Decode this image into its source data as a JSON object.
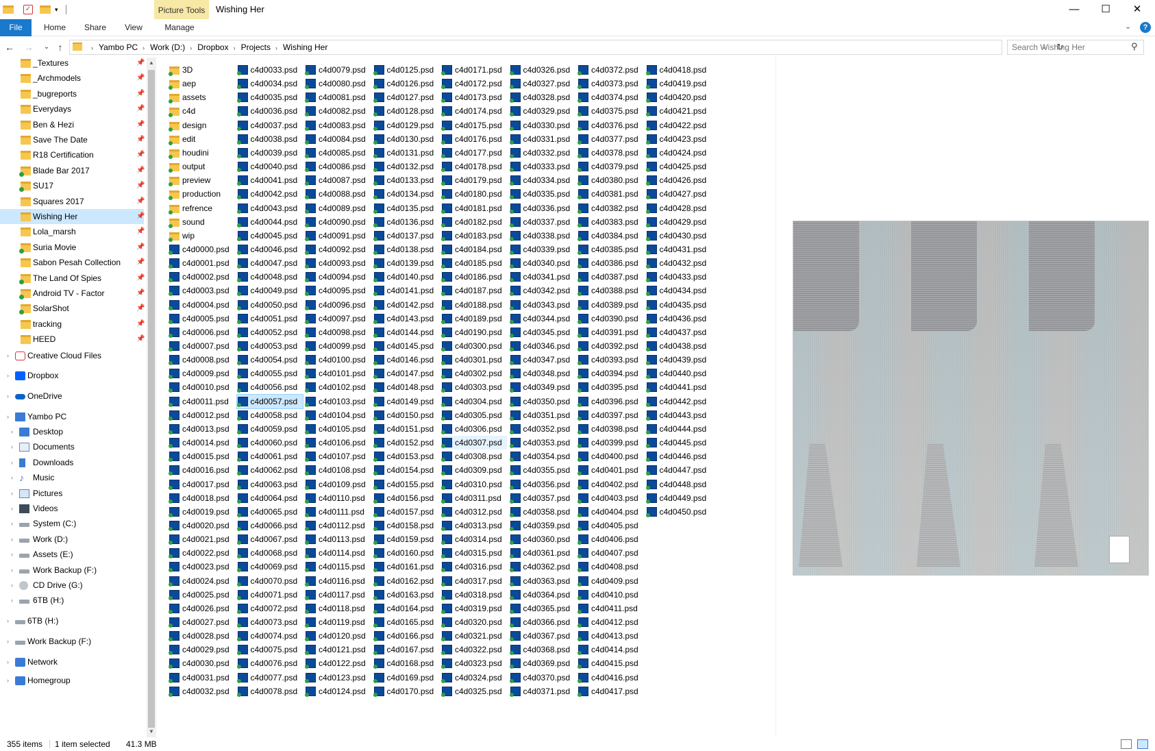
{
  "window": {
    "title": "Wishing Her",
    "context_tab": "Picture Tools",
    "minimize_glyph": "—",
    "maximize_glyph": "☐",
    "close_glyph": "✕"
  },
  "ribbon": {
    "tabs": [
      "File",
      "Home",
      "Share",
      "View",
      "Manage"
    ],
    "expand_glyph": "⌄",
    "help_glyph": "?"
  },
  "nav": {
    "back": "←",
    "forward": "→",
    "recent": "⌄",
    "up": "↑",
    "breadcrumbs": [
      "Yambo PC",
      "Work (D:)",
      "Dropbox",
      "Projects",
      "Wishing Her"
    ],
    "breadcrumb_sep": "›",
    "dropdown": "⌄",
    "refresh": "↻"
  },
  "search": {
    "placeholder": "Search Wishing Her",
    "icon": "search-icon"
  },
  "navpane": {
    "quick_access": [
      {
        "label": "_Textures",
        "icon": "folder"
      },
      {
        "label": "_Archmodels",
        "icon": "folder"
      },
      {
        "label": "_bugreports",
        "icon": "folder"
      },
      {
        "label": "Everydays",
        "icon": "folder"
      },
      {
        "label": "Ben & Hezi",
        "icon": "folder"
      },
      {
        "label": "Save The Date",
        "icon": "folder"
      },
      {
        "label": "R18 Certification",
        "icon": "folder"
      },
      {
        "label": "Blade Bar 2017",
        "icon": "folder-sync"
      },
      {
        "label": "SU17",
        "icon": "folder-sync"
      },
      {
        "label": "Squares 2017",
        "icon": "folder"
      },
      {
        "label": "Wishing Her",
        "icon": "folder",
        "selected": true
      },
      {
        "label": "Lola_marsh",
        "icon": "folder"
      },
      {
        "label": "Suria Movie",
        "icon": "folder-sync"
      },
      {
        "label": "Sabon Pesah Collection",
        "icon": "folder"
      },
      {
        "label": "The Land Of Spies",
        "icon": "folder-sync"
      },
      {
        "label": "Android TV - Factor",
        "icon": "folder-sync"
      },
      {
        "label": "SolarShot",
        "icon": "folder-sync"
      },
      {
        "label": "tracking",
        "icon": "folder"
      },
      {
        "label": "HEED",
        "icon": "folder"
      }
    ],
    "pin_glyph": "📌",
    "creative_cloud": "Creative Cloud Files",
    "dropbox": "Dropbox",
    "onedrive": "OneDrive",
    "this_pc": "Yambo PC",
    "pc_children": [
      {
        "label": "Desktop",
        "icon": "pc"
      },
      {
        "label": "Documents",
        "icon": "doc"
      },
      {
        "label": "Downloads",
        "icon": "download"
      },
      {
        "label": "Music",
        "icon": "music"
      },
      {
        "label": "Pictures",
        "icon": "pics"
      },
      {
        "label": "Videos",
        "icon": "video"
      },
      {
        "label": "System (C:)",
        "icon": "drive"
      },
      {
        "label": "Work (D:)",
        "icon": "drive"
      },
      {
        "label": "Assets (E:)",
        "icon": "drive"
      },
      {
        "label": "Work Backup (F:)",
        "icon": "drive"
      },
      {
        "label": "CD Drive (G:)",
        "icon": "cd"
      },
      {
        "label": "6TB (H:)",
        "icon": "drive"
      }
    ],
    "drives_root": [
      {
        "label": "6TB (H:)",
        "icon": "drive"
      },
      {
        "label": "Work Backup (F:)",
        "icon": "drive"
      }
    ],
    "network": "Network",
    "homegroup": "Homegroup",
    "chevron": "›"
  },
  "scrollbar": {
    "up": "▲",
    "down": "▼"
  },
  "files": {
    "folders": [
      "3D",
      "aep",
      "assets",
      "c4d",
      "design",
      "edit",
      "houdini",
      "output",
      "preview",
      "production",
      "refrence",
      "sound",
      "wip"
    ],
    "columns": [
      [
        "c4d0000.psd",
        "c4d0001.psd",
        "c4d0002.psd",
        "c4d0003.psd",
        "c4d0004.psd",
        "c4d0005.psd",
        "c4d0006.psd",
        "c4d0007.psd",
        "c4d0008.psd",
        "c4d0009.psd",
        "c4d0010.psd",
        "c4d0011.psd",
        "c4d0012.psd",
        "c4d0013.psd",
        "c4d0014.psd",
        "c4d0015.psd",
        "c4d0016.psd",
        "c4d0017.psd",
        "c4d0018.psd",
        "c4d0019.psd",
        "c4d0020.psd",
        "c4d0021.psd",
        "c4d0022.psd",
        "c4d0023.psd",
        "c4d0024.psd",
        "c4d0025.psd",
        "c4d0026.psd",
        "c4d0027.psd",
        "c4d0028.psd",
        "c4d0029.psd",
        "c4d0030.psd",
        "c4d0031.psd",
        "c4d0032.psd"
      ],
      [
        "c4d0033.psd",
        "c4d0034.psd",
        "c4d0035.psd",
        "c4d0036.psd",
        "c4d0037.psd",
        "c4d0038.psd",
        "c4d0039.psd",
        "c4d0040.psd",
        "c4d0041.psd",
        "c4d0042.psd",
        "c4d0043.psd",
        "c4d0044.psd",
        "c4d0045.psd",
        "c4d0046.psd",
        "c4d0047.psd",
        "c4d0048.psd",
        "c4d0049.psd",
        "c4d0050.psd",
        "c4d0051.psd",
        "c4d0052.psd",
        "c4d0053.psd",
        "c4d0054.psd",
        "c4d0055.psd",
        "c4d0056.psd",
        "c4d0057.psd",
        "c4d0058.psd",
        "c4d0059.psd",
        "c4d0060.psd",
        "c4d0061.psd",
        "c4d0062.psd",
        "c4d0063.psd",
        "c4d0064.psd",
        "c4d0065.psd",
        "c4d0066.psd",
        "c4d0067.psd",
        "c4d0068.psd",
        "c4d0069.psd",
        "c4d0070.psd",
        "c4d0071.psd",
        "c4d0072.psd",
        "c4d0073.psd",
        "c4d0074.psd",
        "c4d0075.psd",
        "c4d0076.psd",
        "c4d0077.psd",
        "c4d0078.psd"
      ],
      [
        "c4d0079.psd",
        "c4d0080.psd",
        "c4d0081.psd",
        "c4d0082.psd",
        "c4d0083.psd",
        "c4d0084.psd",
        "c4d0085.psd",
        "c4d0086.psd",
        "c4d0087.psd",
        "c4d0088.psd",
        "c4d0089.psd",
        "c4d0090.psd",
        "c4d0091.psd",
        "c4d0092.psd",
        "c4d0093.psd",
        "c4d0094.psd",
        "c4d0095.psd",
        "c4d0096.psd",
        "c4d0097.psd",
        "c4d0098.psd",
        "c4d0099.psd",
        "c4d0100.psd",
        "c4d0101.psd",
        "c4d0102.psd",
        "c4d0103.psd",
        "c4d0104.psd",
        "c4d0105.psd",
        "c4d0106.psd",
        "c4d0107.psd",
        "c4d0108.psd",
        "c4d0109.psd",
        "c4d0110.psd",
        "c4d0111.psd",
        "c4d0112.psd",
        "c4d0113.psd",
        "c4d0114.psd",
        "c4d0115.psd",
        "c4d0116.psd",
        "c4d0117.psd",
        "c4d0118.psd",
        "c4d0119.psd",
        "c4d0120.psd",
        "c4d0121.psd",
        "c4d0122.psd",
        "c4d0123.psd",
        "c4d0124.psd"
      ],
      [
        "c4d0125.psd",
        "c4d0126.psd",
        "c4d0127.psd",
        "c4d0128.psd",
        "c4d0129.psd",
        "c4d0130.psd",
        "c4d0131.psd",
        "c4d0132.psd",
        "c4d0133.psd",
        "c4d0134.psd",
        "c4d0135.psd",
        "c4d0136.psd",
        "c4d0137.psd",
        "c4d0138.psd",
        "c4d0139.psd",
        "c4d0140.psd",
        "c4d0141.psd",
        "c4d0142.psd",
        "c4d0143.psd",
        "c4d0144.psd",
        "c4d0145.psd",
        "c4d0146.psd",
        "c4d0147.psd",
        "c4d0148.psd",
        "c4d0149.psd",
        "c4d0150.psd",
        "c4d0151.psd",
        "c4d0152.psd",
        "c4d0153.psd",
        "c4d0154.psd",
        "c4d0155.psd",
        "c4d0156.psd",
        "c4d0157.psd",
        "c4d0158.psd",
        "c4d0159.psd",
        "c4d0160.psd",
        "c4d0161.psd",
        "c4d0162.psd",
        "c4d0163.psd",
        "c4d0164.psd",
        "c4d0165.psd",
        "c4d0166.psd",
        "c4d0167.psd",
        "c4d0168.psd",
        "c4d0169.psd",
        "c4d0170.psd"
      ],
      [
        "c4d0171.psd",
        "c4d0172.psd",
        "c4d0173.psd",
        "c4d0174.psd",
        "c4d0175.psd",
        "c4d0176.psd",
        "c4d0177.psd",
        "c4d0178.psd",
        "c4d0179.psd",
        "c4d0180.psd",
        "c4d0181.psd",
        "c4d0182.psd",
        "c4d0183.psd",
        "c4d0184.psd",
        "c4d0185.psd",
        "c4d0186.psd",
        "c4d0187.psd",
        "c4d0188.psd",
        "c4d0189.psd",
        "c4d0190.psd",
        "c4d0300.psd",
        "c4d0301.psd",
        "c4d0302.psd",
        "c4d0303.psd",
        "c4d0304.psd",
        "c4d0305.psd",
        "c4d0306.psd",
        "c4d0307.psd",
        "c4d0308.psd",
        "c4d0309.psd",
        "c4d0310.psd",
        "c4d0311.psd",
        "c4d0312.psd",
        "c4d0313.psd",
        "c4d0314.psd",
        "c4d0315.psd",
        "c4d0316.psd",
        "c4d0317.psd",
        "c4d0318.psd",
        "c4d0319.psd",
        "c4d0320.psd",
        "c4d0321.psd",
        "c4d0322.psd",
        "c4d0323.psd",
        "c4d0324.psd",
        "c4d0325.psd"
      ],
      [
        "c4d0326.psd",
        "c4d0327.psd",
        "c4d0328.psd",
        "c4d0329.psd",
        "c4d0330.psd",
        "c4d0331.psd",
        "c4d0332.psd",
        "c4d0333.psd",
        "c4d0334.psd",
        "c4d0335.psd",
        "c4d0336.psd",
        "c4d0337.psd",
        "c4d0338.psd",
        "c4d0339.psd",
        "c4d0340.psd",
        "c4d0341.psd",
        "c4d0342.psd",
        "c4d0343.psd",
        "c4d0344.psd",
        "c4d0345.psd",
        "c4d0346.psd",
        "c4d0347.psd",
        "c4d0348.psd",
        "c4d0349.psd",
        "c4d0350.psd",
        "c4d0351.psd",
        "c4d0352.psd",
        "c4d0353.psd",
        "c4d0354.psd",
        "c4d0355.psd",
        "c4d0356.psd",
        "c4d0357.psd",
        "c4d0358.psd",
        "c4d0359.psd",
        "c4d0360.psd",
        "c4d0361.psd",
        "c4d0362.psd",
        "c4d0363.psd",
        "c4d0364.psd",
        "c4d0365.psd",
        "c4d0366.psd",
        "c4d0367.psd",
        "c4d0368.psd",
        "c4d0369.psd",
        "c4d0370.psd",
        "c4d0371.psd"
      ],
      [
        "c4d0372.psd",
        "c4d0373.psd",
        "c4d0374.psd",
        "c4d0375.psd",
        "c4d0376.psd",
        "c4d0377.psd",
        "c4d0378.psd",
        "c4d0379.psd",
        "c4d0380.psd",
        "c4d0381.psd",
        "c4d0382.psd",
        "c4d0383.psd",
        "c4d0384.psd",
        "c4d0385.psd",
        "c4d0386.psd",
        "c4d0387.psd",
        "c4d0388.psd",
        "c4d0389.psd",
        "c4d0390.psd",
        "c4d0391.psd",
        "c4d0392.psd",
        "c4d0393.psd",
        "c4d0394.psd",
        "c4d0395.psd",
        "c4d0396.psd",
        "c4d0397.psd",
        "c4d0398.psd",
        "c4d0399.psd",
        "c4d0400.psd",
        "c4d0401.psd",
        "c4d0402.psd",
        "c4d0403.psd",
        "c4d0404.psd",
        "c4d0405.psd",
        "c4d0406.psd",
        "c4d0407.psd",
        "c4d0408.psd",
        "c4d0409.psd",
        "c4d0410.psd",
        "c4d0411.psd",
        "c4d0412.psd",
        "c4d0413.psd",
        "c4d0414.psd",
        "c4d0415.psd",
        "c4d0416.psd",
        "c4d0417.psd"
      ],
      [
        "c4d0418.psd",
        "c4d0419.psd",
        "c4d0420.psd",
        "c4d0421.psd",
        "c4d0422.psd",
        "c4d0423.psd",
        "c4d0424.psd",
        "c4d0425.psd",
        "c4d0426.psd",
        "c4d0427.psd",
        "c4d0428.psd",
        "c4d0429.psd",
        "c4d0430.psd",
        "c4d0431.psd",
        "c4d0432.psd",
        "c4d0433.psd",
        "c4d0434.psd",
        "c4d0435.psd",
        "c4d0436.psd",
        "c4d0437.psd",
        "c4d0438.psd",
        "c4d0439.psd",
        "c4d0440.psd",
        "c4d0441.psd",
        "c4d0442.psd",
        "c4d0443.psd",
        "c4d0444.psd",
        "c4d0445.psd",
        "c4d0446.psd",
        "c4d0447.psd",
        "c4d0448.psd",
        "c4d0449.psd",
        "c4d0450.psd"
      ]
    ],
    "selected": "c4d0057.psd",
    "hovered": "c4d0307.psd"
  },
  "status": {
    "items": "355 items",
    "selected": "1 item selected",
    "size": "41.3 MB"
  }
}
